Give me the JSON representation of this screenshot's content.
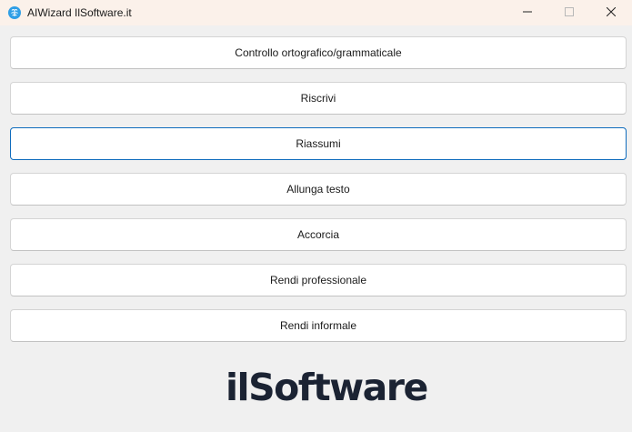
{
  "window": {
    "title": "AIWizard IlSoftware.it",
    "accent": "#0f6cbd",
    "icons": {
      "app": "brain-icon",
      "minimize": "minimize-icon",
      "maximize": "maximize-icon",
      "close": "close-icon"
    }
  },
  "actions": [
    {
      "label": "Controllo ortografico/grammaticale"
    },
    {
      "label": "Riscrivi"
    },
    {
      "label": "Riassumi",
      "focused": true
    },
    {
      "label": "Allunga testo"
    },
    {
      "label": "Accorcia"
    },
    {
      "label": "Rendi professionale"
    },
    {
      "label": "Rendi informale"
    }
  ],
  "logo": {
    "text": "ilSoftware",
    "color": "#1b2333"
  }
}
